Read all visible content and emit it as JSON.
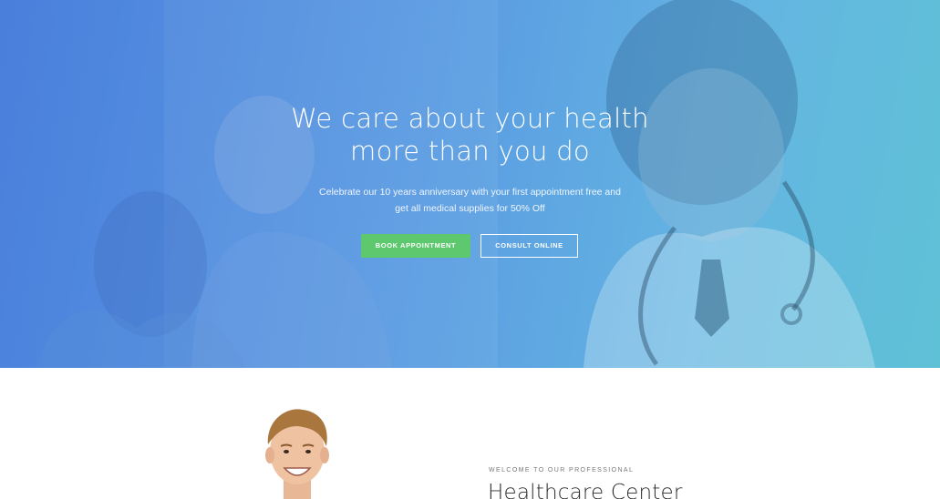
{
  "hero": {
    "title_line1": "We care about your health",
    "title_line2": "more than you do",
    "subtitle_line1": "Celebrate our 10 years anniversary with your first appointment free and",
    "subtitle_line2": "get all medical supplies for 50% Off",
    "book_button": "BOOK APPOINTMENT",
    "consult_button": "CONSULT ONLINE"
  },
  "about": {
    "eyebrow": "WELCOME TO OUR PROFESSIONAL",
    "title": "Healthcare Center"
  },
  "colors": {
    "hero_gradient_start": "#4a7fdc",
    "hero_gradient_end": "#5fc1d6",
    "book_button_bg": "#5dc86e"
  }
}
